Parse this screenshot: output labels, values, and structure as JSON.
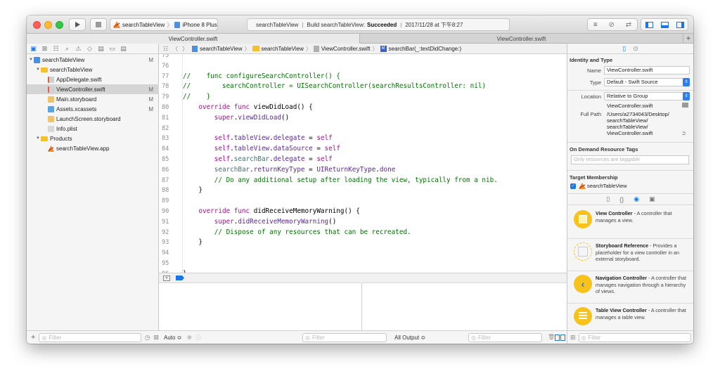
{
  "toolbar": {
    "scheme_name": "searchTableView",
    "device_name": "iPhone 8 Plus",
    "activity_project": "searchTableView",
    "activity_build_prefix": "Build searchTableView:",
    "activity_build_status": "Succeeded",
    "activity_time": "2017/11/28 at 下午8:27",
    "separator": "|",
    "run_icon": "play-icon",
    "stop_icon": "stop-icon"
  },
  "tabs": [
    {
      "label": "ViewController.swift"
    },
    {
      "label": "ViewController.swift"
    }
  ],
  "add_tab_label": "+",
  "navigator": {
    "tree": [
      {
        "label": "searchTableView",
        "status": "M",
        "depth": 0,
        "kind": "project",
        "expanded": true
      },
      {
        "label": "searchTableView",
        "status": "",
        "depth": 1,
        "kind": "folder",
        "expanded": true
      },
      {
        "label": "AppDelegate.swift",
        "status": "",
        "depth": 2,
        "kind": "swift"
      },
      {
        "label": "ViewController.swift",
        "status": "M",
        "depth": 2,
        "kind": "swift",
        "selected": true
      },
      {
        "label": "Main.storyboard",
        "status": "M",
        "depth": 2,
        "kind": "storyboard"
      },
      {
        "label": "Assets.xcassets",
        "status": "M",
        "depth": 2,
        "kind": "assets"
      },
      {
        "label": "LaunchScreen.storyboard",
        "status": "",
        "depth": 2,
        "kind": "storyboard"
      },
      {
        "label": "Info.plist",
        "status": "",
        "depth": 2,
        "kind": "plist"
      },
      {
        "label": "Products",
        "status": "",
        "depth": 1,
        "kind": "folder",
        "expanded": true
      },
      {
        "label": "searchTableView.app",
        "status": "",
        "depth": 2,
        "kind": "app"
      }
    ],
    "filter_placeholder": "Filter",
    "add_label": "+"
  },
  "jumpbar": {
    "items": [
      "searchTableView",
      "searchTableView",
      "ViewController.swift",
      "searchBar(_:textDidChange:)"
    ],
    "method_badge": "M"
  },
  "code": [
    {
      "n": "75",
      "t": []
    },
    {
      "n": "76",
      "t": []
    },
    {
      "n": "77",
      "t": [
        [
          "c-cmt",
          "//    func configureSearchController() {"
        ]
      ]
    },
    {
      "n": "78",
      "t": [
        [
          "c-cmt",
          "//        searchController = UISearchController(searchResultsController: nil)"
        ]
      ]
    },
    {
      "n": "79",
      "t": [
        [
          "c-cmt",
          "//    }"
        ]
      ]
    },
    {
      "n": "80",
      "t": [
        [
          "c-def",
          "    "
        ],
        [
          "c-kw",
          "override func "
        ],
        [
          "c-def",
          "viewDidLoad() {"
        ]
      ]
    },
    {
      "n": "81",
      "t": [
        [
          "c-def",
          "        "
        ],
        [
          "c-kw",
          "super"
        ],
        [
          "c-def",
          "."
        ],
        [
          "c-ty",
          "viewDidLoad"
        ],
        [
          "c-def",
          "()"
        ]
      ]
    },
    {
      "n": "82",
      "t": []
    },
    {
      "n": "83",
      "t": [
        [
          "c-def",
          "        "
        ],
        [
          "c-kw",
          "self"
        ],
        [
          "c-def",
          "."
        ],
        [
          "c-ty",
          "tableView"
        ],
        [
          "c-def",
          "."
        ],
        [
          "c-ty",
          "delegate"
        ],
        [
          "c-def",
          " = "
        ],
        [
          "c-kw",
          "self"
        ]
      ]
    },
    {
      "n": "84",
      "t": [
        [
          "c-def",
          "        "
        ],
        [
          "c-kw",
          "self"
        ],
        [
          "c-def",
          "."
        ],
        [
          "c-ty",
          "tableView"
        ],
        [
          "c-def",
          "."
        ],
        [
          "c-ty",
          "dataSource"
        ],
        [
          "c-def",
          " = "
        ],
        [
          "c-kw",
          "self"
        ]
      ]
    },
    {
      "n": "85",
      "t": [
        [
          "c-def",
          "        "
        ],
        [
          "c-kw",
          "self"
        ],
        [
          "c-def",
          "."
        ],
        [
          "c-id",
          "searchBar"
        ],
        [
          "c-def",
          "."
        ],
        [
          "c-ty",
          "delegate"
        ],
        [
          "c-def",
          " = "
        ],
        [
          "c-kw",
          "self"
        ]
      ]
    },
    {
      "n": "86",
      "t": [
        [
          "c-def",
          "        "
        ],
        [
          "c-id",
          "searchBar"
        ],
        [
          "c-def",
          "."
        ],
        [
          "c-ty",
          "returnKeyType"
        ],
        [
          "c-def",
          " = "
        ],
        [
          "c-ty",
          "UIReturnKeyType"
        ],
        [
          "c-def",
          "."
        ],
        [
          "c-ty",
          "done"
        ]
      ]
    },
    {
      "n": "87",
      "t": [
        [
          "c-def",
          "        "
        ],
        [
          "c-cmt",
          "// Do any additional setup after loading the view, typically from a nib."
        ]
      ]
    },
    {
      "n": "88",
      "t": [
        [
          "c-def",
          "    }"
        ]
      ]
    },
    {
      "n": "89",
      "t": []
    },
    {
      "n": "90",
      "t": [
        [
          "c-def",
          "    "
        ],
        [
          "c-kw",
          "override func "
        ],
        [
          "c-def",
          "didReceiveMemoryWarning() {"
        ]
      ]
    },
    {
      "n": "91",
      "t": [
        [
          "c-def",
          "        "
        ],
        [
          "c-kw",
          "super"
        ],
        [
          "c-def",
          "."
        ],
        [
          "c-ty",
          "didReceiveMemoryWarning"
        ],
        [
          "c-def",
          "()"
        ]
      ]
    },
    {
      "n": "92",
      "t": [
        [
          "c-def",
          "        "
        ],
        [
          "c-cmt",
          "// Dispose of any resources that can be recreated."
        ]
      ]
    },
    {
      "n": "93",
      "t": [
        [
          "c-def",
          "    }"
        ]
      ]
    },
    {
      "n": "94",
      "t": []
    },
    {
      "n": "95",
      "t": []
    },
    {
      "n": "96",
      "t": [
        [
          "c-def",
          "}"
        ]
      ]
    },
    {
      "n": "97",
      "t": []
    }
  ],
  "debug": {
    "auto_label": "Auto ≎",
    "output_label": "All Output ≎",
    "filter_placeholder": "Filter"
  },
  "inspector": {
    "identity_header": "Identity and Type",
    "name_label": "Name",
    "name_value": "ViewController.swift",
    "type_label": "Type",
    "type_value": "Default - Swift Source",
    "location_label": "Location",
    "location_value": "Relative to Group",
    "location_file": "ViewController.swift",
    "fullpath_label": "Full Path",
    "fullpath_lines": [
      "/Users/a2734043/Desktop/",
      "searchTableView/",
      "searchTableView/",
      "ViewController.swift"
    ],
    "odr_header": "On Demand Resource Tags",
    "odr_placeholder": "Only resources are taggable",
    "target_header": "Target Membership",
    "target_name": "searchTableView",
    "library": [
      {
        "title": "View Controller",
        "desc": " - A controller that manages a view.",
        "color": "#f7c21c",
        "icon": "view-controller-icon"
      },
      {
        "title": "Storyboard Reference",
        "desc": " - Provides a placeholder for a view controller in an external storyboard.",
        "color": "#f7c21c",
        "icon": "storyboard-reference-icon"
      },
      {
        "title": "Navigation Controller",
        "desc": " - A controller that manages navigation through a hierarchy of views.",
        "color": "#f7c21c",
        "icon": "navigation-controller-icon"
      },
      {
        "title": "Table View Controller",
        "desc": " - A controller that manages a table view.",
        "color": "#f7c21c",
        "icon": "table-view-controller-icon"
      }
    ],
    "filter_placeholder": "Filter"
  },
  "colors": {
    "accent": "#1a76e3",
    "close": "#fc5f57",
    "minimize": "#fdbc2e",
    "zoom": "#33c748",
    "comment": "#007400",
    "keyword": "#aa0d91",
    "library_yellow": "#f7c21c"
  }
}
